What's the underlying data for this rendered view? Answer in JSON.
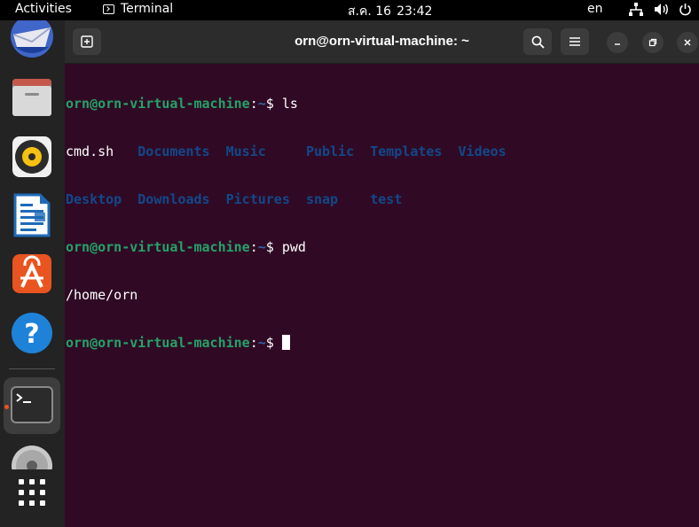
{
  "topbar": {
    "activities": "Activities",
    "app_name": "Terminal",
    "date": "ส.ค. 16",
    "time": "23:42",
    "language": "en"
  },
  "dock": {
    "items": [
      "thunderbird-icon",
      "files-icon",
      "rhythmbox-icon",
      "libreoffice-writer-icon",
      "app-center-icon",
      "help-icon",
      "terminal-icon",
      "dvd-icon",
      "show-apps-icon"
    ]
  },
  "window": {
    "title": "orn@orn-virtual-machine: ~"
  },
  "terminal": {
    "prompt_user": "orn@orn-virtual-machine",
    "prompt_sep": ":",
    "prompt_path": "~",
    "prompt_symbol": "$",
    "cmd1": "ls",
    "ls_row1": {
      "file": "cmd.sh",
      "dirs": [
        "Documents",
        "Music",
        "Public",
        "Templates",
        "Videos"
      ]
    },
    "ls_row2": [
      "Desktop",
      "Downloads",
      "Pictures",
      "snap",
      "test"
    ],
    "cmd2": "pwd",
    "pwd_output": "/home/orn"
  },
  "colors": {
    "terminal_bg": "#300a24",
    "prompt_user": "#26a269",
    "prompt_path": "#3465a4",
    "directory": "#12488b",
    "accent": "#e95420"
  }
}
